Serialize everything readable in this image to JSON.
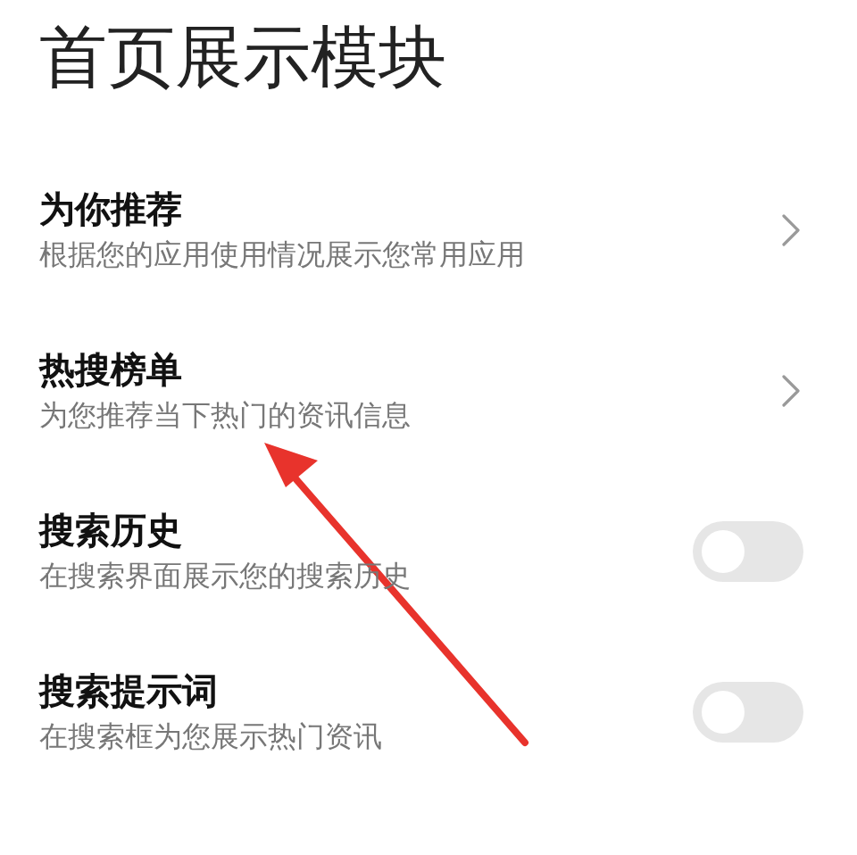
{
  "page": {
    "title": "首页展示模块"
  },
  "items": [
    {
      "kind": "link",
      "title": "为你推荐",
      "subtitle": "根据您的应用使用情况展示您常用应用"
    },
    {
      "kind": "link",
      "title": "热搜榜单",
      "subtitle": "为您推荐当下热门的资讯信息"
    },
    {
      "kind": "switch",
      "title": "搜索历史",
      "subtitle": "在搜索界面展示您的搜索历史",
      "on": false
    },
    {
      "kind": "switch",
      "title": "搜索提示词",
      "subtitle": "在搜索框为您展示热门资讯",
      "on": false
    }
  ]
}
